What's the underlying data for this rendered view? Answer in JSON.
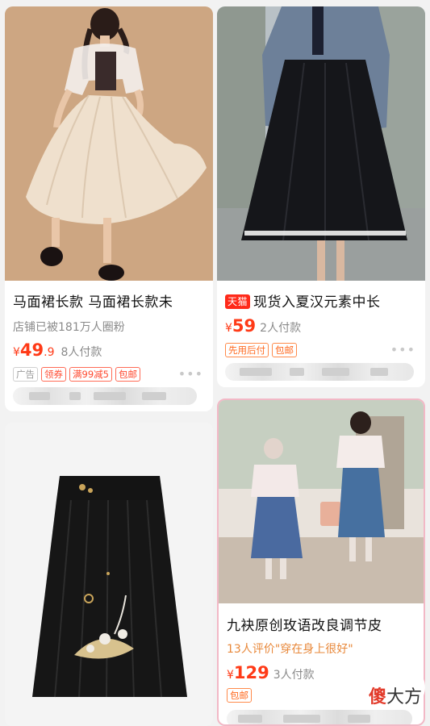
{
  "products": [
    {
      "title": "马面裙长款 马面裙长款未",
      "subtitle": "店铺已被181万人圈粉",
      "price_symbol": "¥",
      "price_int": "49",
      "price_dec": ".9",
      "sold": "8人付款",
      "tags": [
        "广告",
        "领券",
        "满99减5",
        "包邮"
      ],
      "more": "•••"
    },
    {
      "badge": "天猫",
      "title": "现货入夏汉元素中长",
      "price_symbol": "¥",
      "price_int": "59",
      "sold": "2人付款",
      "tags": [
        "先用后付",
        "包邮"
      ],
      "more": "•••"
    },
    {
      "title": "九袂原创玫语改良调节皮",
      "subtitle": "13人评价\"穿在身上很好\"",
      "price_symbol": "¥",
      "price_int": "129",
      "sold": "3人付款",
      "tags": [
        "包邮"
      ]
    }
  ],
  "watermark": {
    "text_red": "傻",
    "text_dark": "大方"
  },
  "colors": {
    "price": "#ff3a17",
    "tmall": "#ff2a1a",
    "background": "#f2f2f2"
  }
}
